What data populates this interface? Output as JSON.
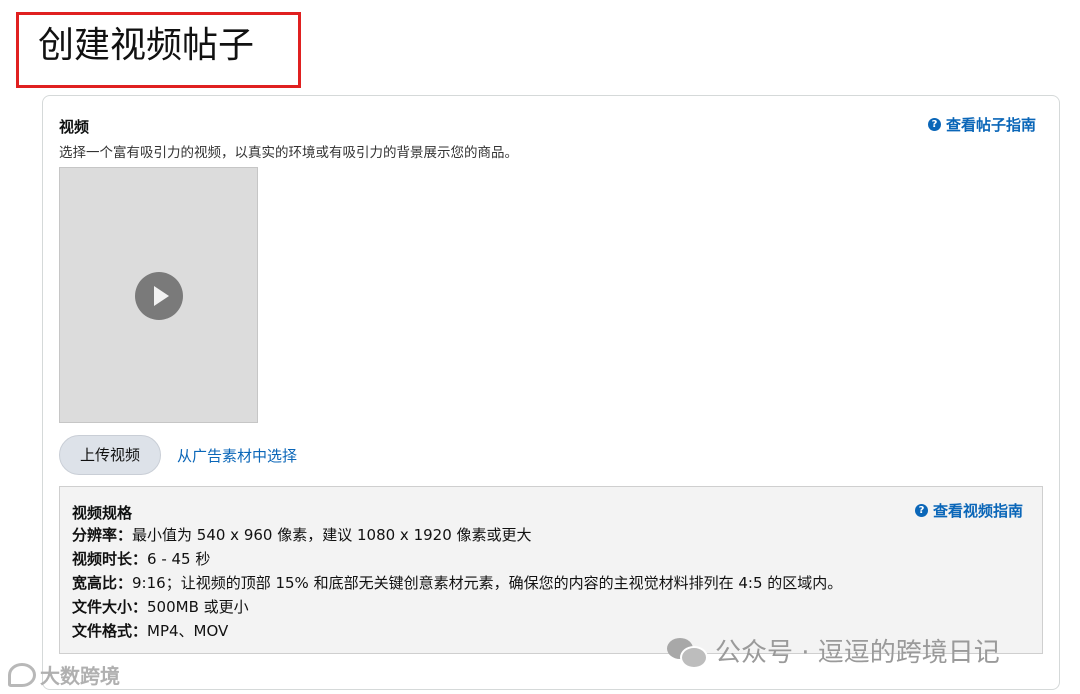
{
  "page": {
    "title": "创建视频帖子"
  },
  "video_section": {
    "label": "视频",
    "description": "选择一个富有吸引力的视频，以真实的环境或有吸引力的背景展示您的商品。",
    "post_guide_link": "查看帖子指南",
    "upload_button": "上传视频",
    "library_link": "从广告素材中选择"
  },
  "specs": {
    "title": "视频规格",
    "guide_link": "查看视频指南",
    "rows": [
      {
        "key": "分辨率：",
        "value": "最小值为 540 x 960 像素，建议 1080 x 1920 像素或更大"
      },
      {
        "key": "视频时长：",
        "value": "6 - 45 秒"
      },
      {
        "key": "宽高比：",
        "value": "9:16；让视频的顶部 15% 和底部无关键创意素材元素，确保您的内容的主视觉材料排列在 4:5 的区域内。"
      },
      {
        "key": "文件大小：",
        "value": "500MB 或更小"
      },
      {
        "key": "文件格式：",
        "value": "MP4、MOV"
      }
    ]
  },
  "watermarks": {
    "wechat_account": "公众号 · 逗逗的跨境日记",
    "corner_logo": "大数跨境"
  },
  "icons": {
    "help": "question-circle-icon",
    "play": "play-icon",
    "wechat": "wechat-icon"
  },
  "colors": {
    "link": "#0a66b8",
    "highlight_border": "#e02020",
    "preview_bg": "#dcdcdc",
    "specs_bg": "#f3f3f3"
  }
}
